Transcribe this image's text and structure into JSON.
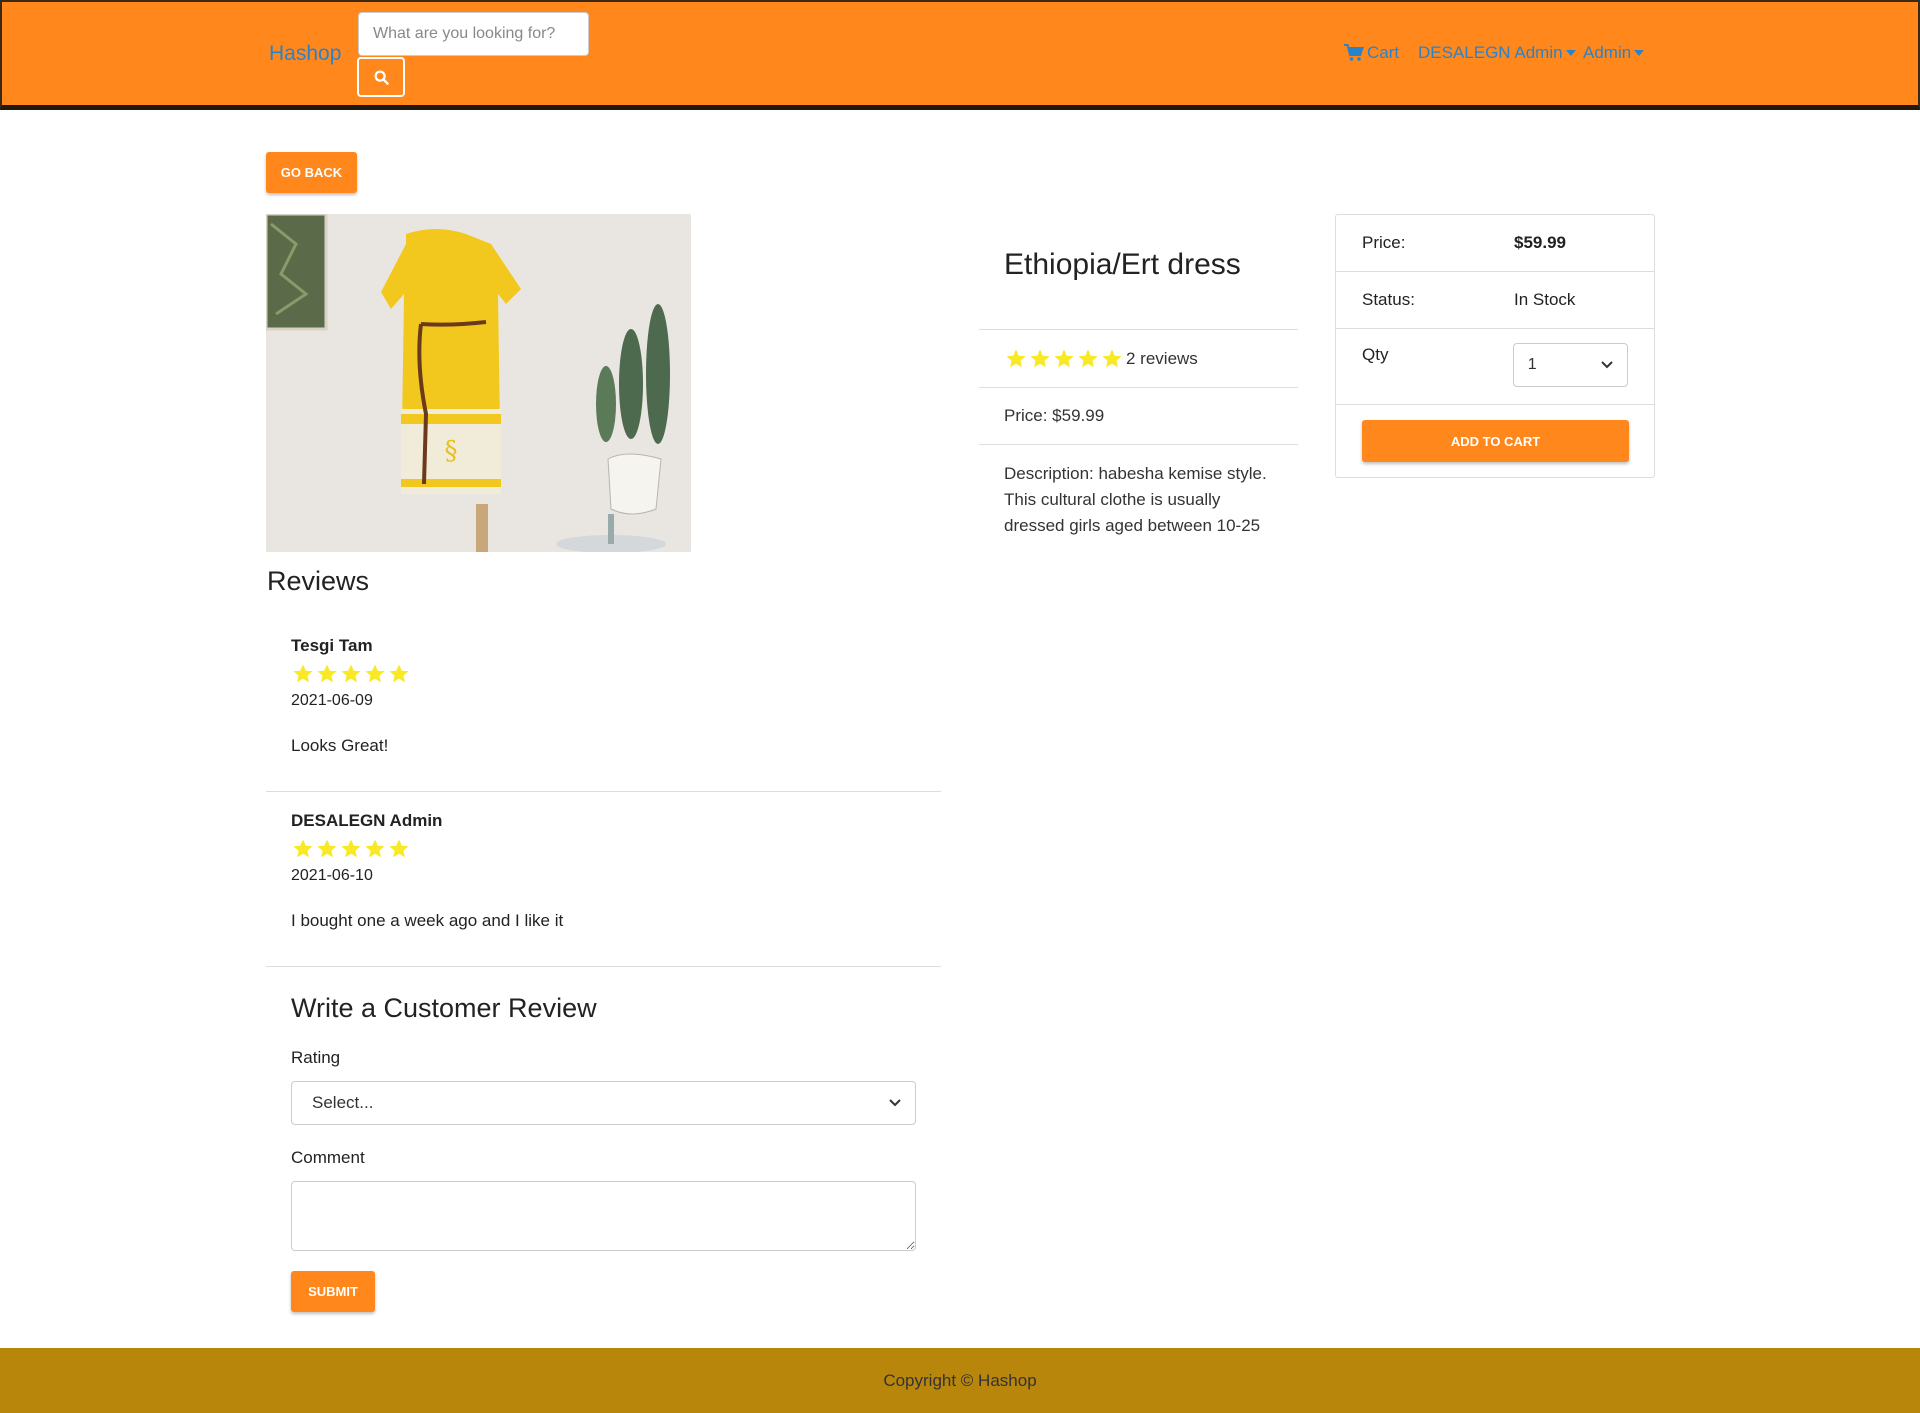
{
  "navbar": {
    "brand": "Hashop",
    "search_placeholder": "What are you looking for?",
    "cart_label": "Cart",
    "user_menu": "DESALEGN Admin",
    "admin_menu": "Admin",
    "bg_color": "#ff871c"
  },
  "go_back_label": "GO BACK",
  "product": {
    "name": "Ethiopia/Ert dress",
    "rating": 5,
    "reviews_text": "2 reviews",
    "price_line": "Price: $59.99",
    "description_line1": "Description: habesha kemise style.",
    "description_line2": "This cultural clothe is usually",
    "description_line3": "dressed girls aged between 10-25"
  },
  "buy_card": {
    "price_label": "Price:",
    "price_value": "$59.99",
    "status_label": "Status:",
    "status_value": "In Stock",
    "qty_label": "Qty",
    "qty_value": "1",
    "add_to_cart": "ADD TO CART"
  },
  "reviews": {
    "heading": "Reviews",
    "items": [
      {
        "name": "Tesgi Tam",
        "rating": 5,
        "date": "2021-06-09",
        "comment": "Looks Great!"
      },
      {
        "name": "DESALEGN Admin",
        "rating": 5,
        "date": "2021-06-10",
        "comment": "I bought one a week ago and I like it"
      }
    ]
  },
  "review_form": {
    "heading": "Write a Customer Review",
    "rating_label": "Rating",
    "rating_selected": "Select...",
    "comment_label": "Comment",
    "submit_label": "SUBMIT"
  },
  "footer": {
    "copyright": "Copyright © Hashop",
    "bg_color": "#b8860b"
  },
  "icons": {
    "search": "search-icon",
    "cart": "cart-icon",
    "star": "star-icon",
    "dropdown": "chevron-down-icon"
  }
}
